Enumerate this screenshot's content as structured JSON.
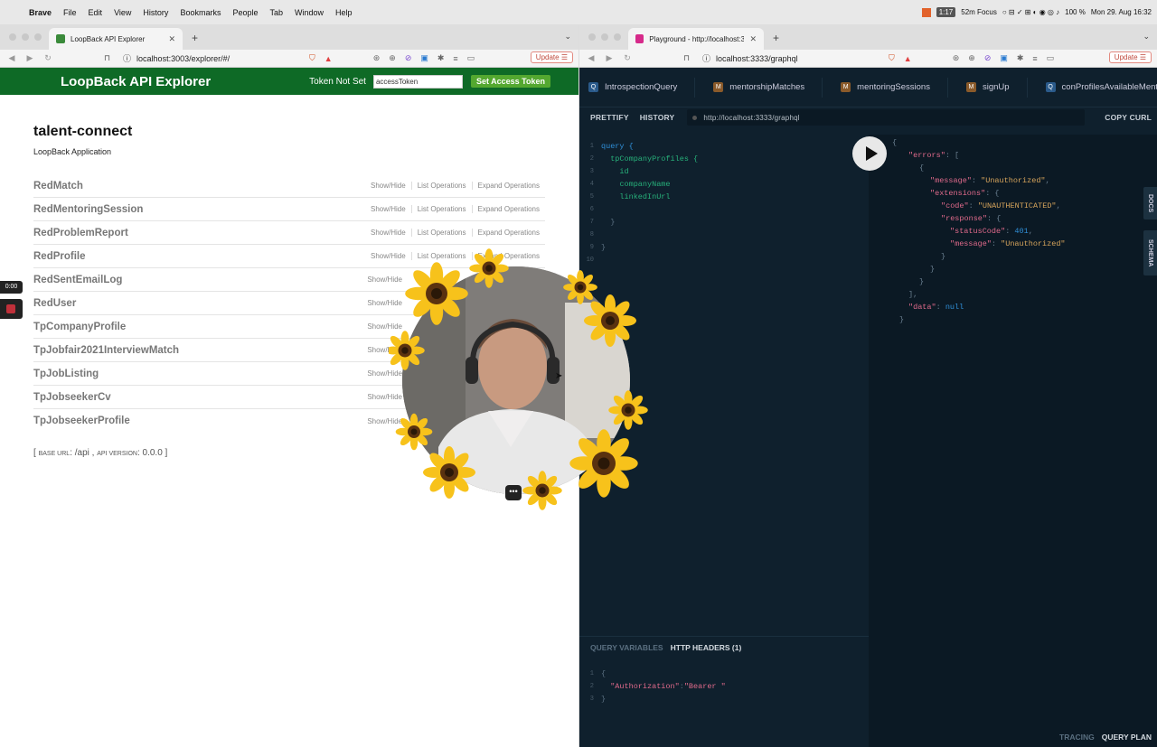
{
  "menubar": {
    "app": "Brave",
    "items": [
      "File",
      "Edit",
      "View",
      "History",
      "Bookmarks",
      "People",
      "Tab",
      "Window",
      "Help"
    ],
    "status": {
      "timer_badge": "1:17",
      "focus": "52m Focus",
      "battery": "100 %",
      "datetime": "Mon 29. Aug  16:32"
    }
  },
  "left_window": {
    "tab_title": "LoopBack API Explorer",
    "url": "localhost:3003/explorer/#/",
    "update_label": "Update",
    "header": {
      "title": "LoopBack API Explorer",
      "token_label": "Token Not Set",
      "token_placeholder": "accessToken",
      "token_button": "Set Access Token"
    },
    "app_title": "talent-connect",
    "app_subtitle": "LoopBack Application",
    "operations": [
      {
        "name": "RedMatch",
        "links": [
          "Show/Hide",
          "List Operations",
          "Expand Operations"
        ]
      },
      {
        "name": "RedMentoringSession",
        "links": [
          "Show/Hide",
          "List Operations",
          "Expand Operations"
        ]
      },
      {
        "name": "RedProblemReport",
        "links": [
          "Show/Hide",
          "List Operations",
          "Expand Operations"
        ]
      },
      {
        "name": "RedProfile",
        "links": [
          "Show/Hide",
          "List Operations",
          "Expand Operations"
        ]
      },
      {
        "name": "RedSentEmailLog",
        "links": [
          "Show/Hide"
        ]
      },
      {
        "name": "RedUser",
        "links": [
          "Show/Hide"
        ]
      },
      {
        "name": "TpCompanyProfile",
        "links": [
          "Show/Hide"
        ]
      },
      {
        "name": "TpJobfair2021InterviewMatch",
        "links": [
          "Show/Hide"
        ]
      },
      {
        "name": "TpJobListing",
        "links": [
          "Show/Hide"
        ]
      },
      {
        "name": "TpJobseekerCv",
        "links": [
          "Show/Hide"
        ]
      },
      {
        "name": "TpJobseekerProfile",
        "links": [
          "Show/Hide"
        ]
      }
    ],
    "base_url": {
      "label": "base url",
      "value": "/api",
      "version_label": "api version",
      "version": "0.0.0"
    },
    "recording_timer": "0:00"
  },
  "right_window": {
    "tab_title": "Playground - http://localhost:3…",
    "url": "localhost:3333/graphql",
    "update_label": "Update",
    "query_tabs": [
      {
        "badge": "Q",
        "label": "IntrospectionQuery"
      },
      {
        "badge": "M",
        "label": "mentorshipMatches"
      },
      {
        "badge": "M",
        "label": "mentoringSessions"
      },
      {
        "badge": "M",
        "label": "signUp"
      },
      {
        "badge": "Q",
        "label": "conProfilesAvailableMentors"
      }
    ],
    "toolbar": {
      "prettify": "PRETTIFY",
      "history": "HISTORY",
      "endpoint": "http://localhost:3333/graphql",
      "copy_curl": "COPY CURL"
    },
    "query_lines": [
      "query {",
      "  tpCompanyProfiles {",
      "    id",
      "    companyName",
      "    linkedInUrl",
      "",
      "  }",
      "",
      "}",
      ""
    ],
    "side_tabs": {
      "docs": "DOCS",
      "schema": "SCHEMA"
    },
    "variables_tabs": {
      "query_variables": "QUERY VARIABLES",
      "http_headers": "HTTP HEADERS (1)"
    },
    "headers": {
      "key": "\"Authorization\"",
      "value": "\"Bearer \""
    },
    "footer": {
      "tracing": "TRACING",
      "query_plan": "QUERY PLAN"
    },
    "result": {
      "errors_key": "\"errors\"",
      "message_key": "\"message\"",
      "message_val": "\"Unauthorized\"",
      "extensions_key": "\"extensions\"",
      "code_key": "\"code\"",
      "code_val": "\"UNAUTHENTICATED\"",
      "response_key": "\"response\"",
      "status_key": "\"statusCode\"",
      "status_val": "401",
      "message2_key": "\"message\"",
      "message2_val": "\"Unauthorized\"",
      "data_key": "\"data\"",
      "data_val": "null"
    }
  }
}
